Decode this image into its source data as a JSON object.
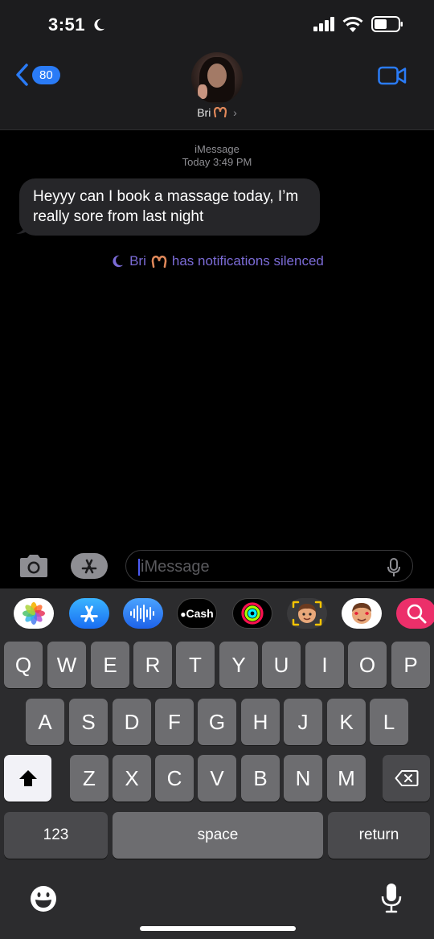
{
  "status_bar": {
    "time": "3:51"
  },
  "header": {
    "back_count": "80",
    "contact_name": "Bri",
    "contact_chevron": "›"
  },
  "conversation": {
    "service": "iMessage",
    "timestamp": "Today 3:49 PM",
    "messages": [
      {
        "from": "contact",
        "text": "Heyyy can I book a massage today, I’m really sore from last night"
      }
    ],
    "silenced_name": "Bri",
    "silenced_text": "has notifications silenced"
  },
  "input": {
    "placeholder": "iMessage",
    "value": ""
  },
  "drawer": {
    "apps": [
      {
        "icon": "photos-icon"
      },
      {
        "icon": "app-store-icon"
      },
      {
        "icon": "audio-message-icon"
      },
      {
        "icon": "apple-cash-icon",
        "label": "Cash"
      },
      {
        "icon": "fitness-rings-icon"
      },
      {
        "icon": "memoji-icon"
      },
      {
        "icon": "memoji-stickers-icon"
      },
      {
        "icon": "image-search-icon"
      }
    ]
  },
  "keyboard": {
    "row1": [
      "Q",
      "W",
      "E",
      "R",
      "T",
      "Y",
      "U",
      "I",
      "O",
      "P"
    ],
    "row2": [
      "A",
      "S",
      "D",
      "F",
      "G",
      "H",
      "J",
      "K",
      "L"
    ],
    "row3": [
      "Z",
      "X",
      "C",
      "V",
      "B",
      "N",
      "M"
    ],
    "numbers_label": "123",
    "space_label": "space",
    "return_label": "return"
  },
  "colors": {
    "accent_blue": "#2a7bf6",
    "silenced_purple": "#7b6bd6",
    "bubble_gray": "#262629",
    "keyboard_bg": "#2c2c2e"
  }
}
